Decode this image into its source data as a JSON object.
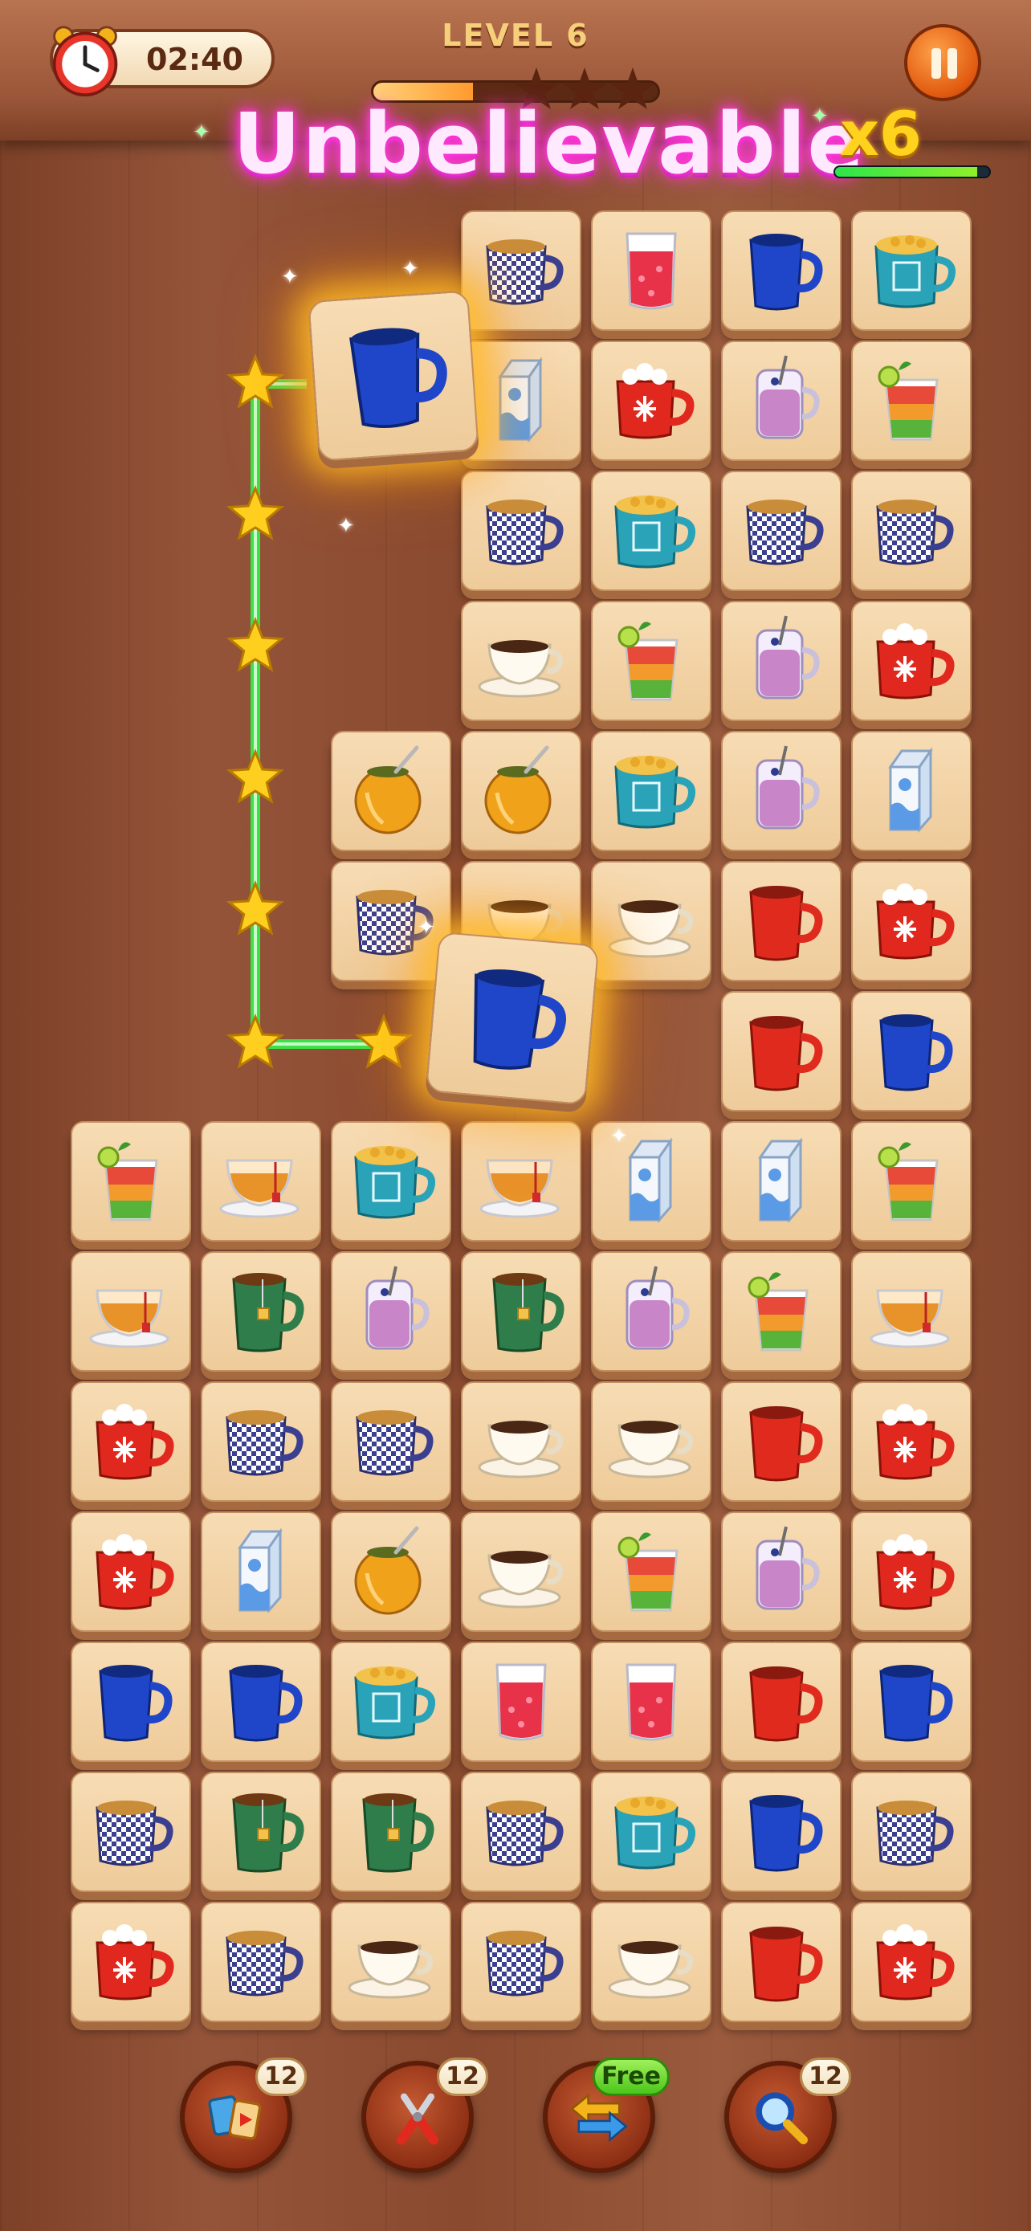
{
  "hud": {
    "timer": "02:40",
    "level_label": "LEVEL  6",
    "level_progress": 0.35,
    "stars_total": 3
  },
  "combo": {
    "text": "Unbelievable",
    "multiplier": "x6",
    "meter": 0.92
  },
  "colors": {
    "combo_glow": "#ff38d9",
    "path_line": "#38e84a",
    "star": "#ffcf1f",
    "tile_face": "#f3d5aa"
  },
  "board": {
    "rows": [
      [
        "",
        "",
        "",
        "checkered-mug",
        "red-juice-glass",
        "blue-mug",
        "teal-cereal-mug"
      ],
      [
        "",
        "",
        "",
        "milk-carton",
        "red-cocoa-mug",
        "pink-smoothie-jar",
        "layered-cocktail"
      ],
      [
        "",
        "",
        "",
        "checkered-mug",
        "teal-cereal-mug",
        "checkered-mug",
        "checkered-mug"
      ],
      [
        "",
        "",
        "",
        "white-teacup",
        "layered-cocktail",
        "pink-smoothie-jar",
        "red-cocoa-mug"
      ],
      [
        "",
        "",
        "mate-gourd",
        "mate-gourd",
        "teal-cereal-mug",
        "pink-smoothie-jar",
        "milk-carton"
      ],
      [
        "",
        "",
        "checkered-mug",
        "white-teacup",
        "white-teacup",
        "red-mug",
        "red-cocoa-mug"
      ],
      [
        "",
        "",
        "",
        "",
        "",
        "red-mug",
        "blue-mug"
      ],
      [
        "layered-cocktail",
        "glass-tea-cup",
        "teal-cereal-mug",
        "glass-tea-cup",
        "milk-carton",
        "milk-carton",
        "layered-cocktail"
      ],
      [
        "glass-tea-cup",
        "green-tea-mug",
        "pink-smoothie-jar",
        "green-tea-mug",
        "pink-smoothie-jar",
        "layered-cocktail",
        "glass-tea-cup"
      ],
      [
        "red-cocoa-mug",
        "checkered-mug",
        "checkered-mug",
        "white-teacup",
        "white-teacup",
        "red-mug",
        "red-cocoa-mug"
      ],
      [
        "red-cocoa-mug",
        "milk-carton",
        "mate-gourd",
        "white-teacup",
        "layered-cocktail",
        "pink-smoothie-jar",
        "red-cocoa-mug"
      ],
      [
        "blue-mug",
        "blue-mug",
        "teal-cereal-mug",
        "red-juice-glass",
        "red-juice-glass",
        "red-mug",
        "blue-mug"
      ],
      [
        "checkered-mug",
        "green-tea-mug",
        "green-tea-mug",
        "checkered-mug",
        "teal-cereal-mug",
        "blue-mug",
        "checkered-mug"
      ],
      [
        "red-cocoa-mug",
        "checkered-mug",
        "white-teacup",
        "checkered-mug",
        "white-teacup",
        "red-mug",
        "red-cocoa-mug"
      ]
    ],
    "matched_pair": [
      "blue-mug",
      "blue-mug"
    ]
  },
  "boosters": [
    {
      "name": "shuffle",
      "count": "12",
      "icon": "cards-icon"
    },
    {
      "name": "remove",
      "count": "12",
      "icon": "pliers-icon"
    },
    {
      "name": "swap",
      "count": "Free",
      "icon": "arrows-icon"
    },
    {
      "name": "hint",
      "count": "12",
      "icon": "magnifier-icon"
    }
  ]
}
